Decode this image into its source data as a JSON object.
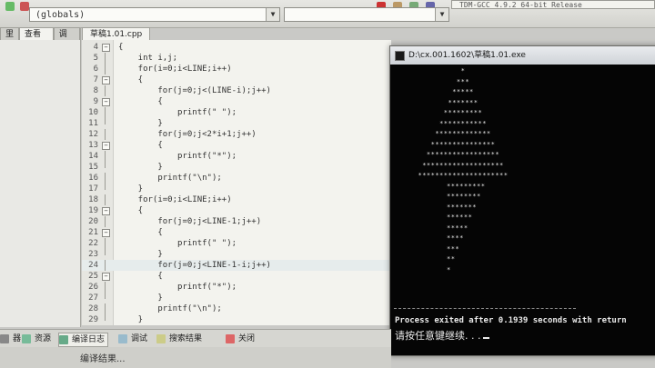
{
  "toolbar": {
    "scope_combo": "(globals)",
    "compiler": "TDM-GCC 4.9.2 64-bit Release"
  },
  "left_panel": {
    "tabs": [
      "里",
      "查看类",
      "调试"
    ]
  },
  "editor": {
    "file_tab": "草稿1.01.cpp",
    "lines": [
      {
        "n": "4",
        "code": "{",
        "fold": "minus"
      },
      {
        "n": "5",
        "code": "    int i,j;",
        "fold": "line"
      },
      {
        "n": "6",
        "code": "    for(i=0;i<LINE;i++)",
        "fold": "line"
      },
      {
        "n": "7",
        "code": "    {",
        "fold": "minus"
      },
      {
        "n": "8",
        "code": "        for(j=0;j<(LINE-i);j++)",
        "fold": "line"
      },
      {
        "n": "9",
        "code": "        {",
        "fold": "minus"
      },
      {
        "n": "10",
        "code": "            printf(\" \");",
        "fold": "line"
      },
      {
        "n": "11",
        "code": "        }",
        "fold": "end"
      },
      {
        "n": "12",
        "code": "        for(j=0;j<2*i+1;j++)",
        "fold": "line"
      },
      {
        "n": "13",
        "code": "        {",
        "fold": "minus"
      },
      {
        "n": "14",
        "code": "            printf(\"*\");",
        "fold": "line"
      },
      {
        "n": "15",
        "code": "        }",
        "fold": "end"
      },
      {
        "n": "16",
        "code": "        printf(\"\\n\");",
        "fold": "line"
      },
      {
        "n": "17",
        "code": "    }",
        "fold": "end"
      },
      {
        "n": "18",
        "code": "    for(i=0;i<LINE;i++)",
        "fold": "line"
      },
      {
        "n": "19",
        "code": "    {",
        "fold": "minus"
      },
      {
        "n": "20",
        "code": "        for(j=0;j<LINE-1;j++)",
        "fold": "line"
      },
      {
        "n": "21",
        "code": "        {",
        "fold": "minus"
      },
      {
        "n": "22",
        "code": "            printf(\" \");",
        "fold": "line"
      },
      {
        "n": "23",
        "code": "        }",
        "fold": "end"
      },
      {
        "n": "24",
        "code": "        for(j=0;j<LINE-1-i;j++)",
        "fold": "line",
        "hl": true
      },
      {
        "n": "25",
        "code": "        {",
        "fold": "minus"
      },
      {
        "n": "26",
        "code": "            printf(\"*\");",
        "fold": "line"
      },
      {
        "n": "27",
        "code": "        }",
        "fold": "end"
      },
      {
        "n": "28",
        "code": "        printf(\"\\n\");",
        "fold": "line"
      },
      {
        "n": "29",
        "code": "    }",
        "fold": "end"
      }
    ]
  },
  "console": {
    "title": "D:\\cx.001.1602\\草稿1.01.exe",
    "triangle_rows": [
      "*",
      "***",
      "*****",
      "*******",
      "*********",
      "***********",
      "*************",
      "***************",
      "*****************",
      "*******************",
      "*********************"
    ],
    "down_rows": [
      "*********",
      "********",
      "*******",
      "******",
      "*****",
      "****",
      "***",
      "**",
      "*"
    ],
    "exit_line": "Process exited after 0.1939 seconds with return",
    "prompt": "请按任意键继续. . ."
  },
  "bottom_tabs": [
    {
      "label": "器",
      "icon": "compiler-icon"
    },
    {
      "label": "资源",
      "icon": "resources-icon"
    },
    {
      "label": "编译日志",
      "icon": "compile-log-icon",
      "active": true
    },
    {
      "label": "调试",
      "icon": "debug-icon"
    },
    {
      "label": "搜索结果",
      "icon": "search-results-icon"
    },
    {
      "label": "关闭",
      "icon": "close-icon"
    }
  ],
  "status": {
    "text": "编译结果..."
  },
  "colors": {
    "console_bg": "#050505",
    "editor_bg": "#f3f3ee",
    "keyword": "#1c1c9c",
    "string": "#7a1c8c"
  }
}
